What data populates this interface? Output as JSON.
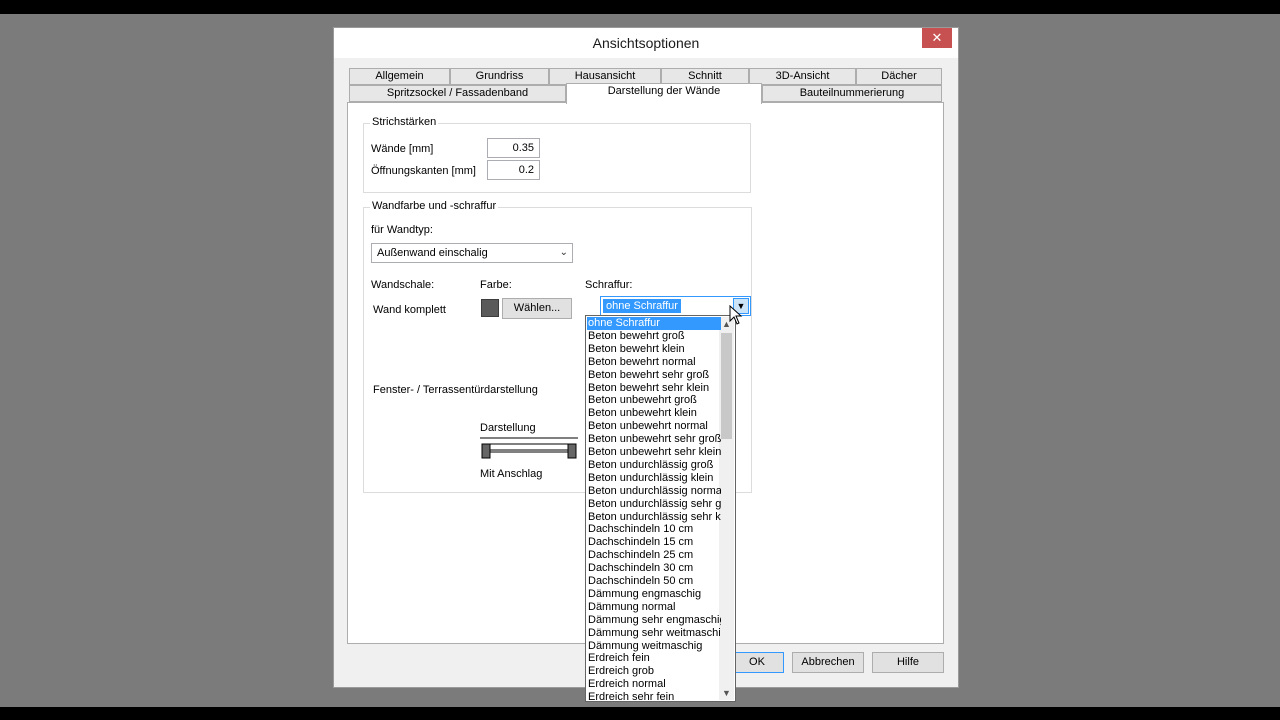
{
  "dialog": {
    "title": "Ansichtsoptionen",
    "close_label": "✕"
  },
  "tabs_row1": [
    "Allgemein",
    "Grundriss",
    "Hausansicht",
    "Schnitt",
    "3D-Ansicht",
    "Dächer"
  ],
  "tabs_row2": [
    "Spritzsockel / Fassadenband",
    "Darstellung der Wände",
    "Bauteilnummerierung"
  ],
  "active_tab": "Darstellung der Wände",
  "strichstaerken": {
    "title": "Strichstärken",
    "waende_label": "Wände [mm]",
    "waende_value": "0.35",
    "oeffnung_label": "Öffnungskanten [mm]",
    "oeffnung_value": "0.2"
  },
  "wandfarbe": {
    "title": "Wandfarbe und -schraffur",
    "wandtyp_label": "für Wandtyp:",
    "wandtyp_value": "Außenwand einschalig",
    "wandschale_label": "Wandschale:",
    "farbe_label": "Farbe:",
    "schraffur_label": "Schraffur:",
    "wand_label": "Wand komplett",
    "waehlen_label": "Wählen...",
    "swatch_color": "#5a5a5a",
    "schraffur_value": "ohne Schraffur",
    "fenster_label": "Fenster- / Terrassentürdarstellung",
    "darstellung_label": "Darstellung",
    "anschlag_label": "Mit Anschlag"
  },
  "dropdown_items": [
    "ohne Schraffur",
    "Beton bewehrt groß",
    "Beton bewehrt klein",
    "Beton bewehrt normal",
    "Beton bewehrt sehr groß",
    "Beton bewehrt sehr klein",
    "Beton unbewehrt groß",
    "Beton unbewehrt klein",
    "Beton unbewehrt normal",
    "Beton unbewehrt sehr groß",
    "Beton unbewehrt sehr klein",
    "Beton undurchlässig groß",
    "Beton undurchlässig klein",
    "Beton undurchlässig normal",
    "Beton undurchlässig sehr gr",
    "Beton undurchlässig sehr kle",
    "Dachschindeln 10 cm",
    "Dachschindeln 15 cm",
    "Dachschindeln 25 cm",
    "Dachschindeln 30 cm",
    "Dachschindeln 50 cm",
    "Dämmung engmaschig",
    "Dämmung normal",
    "Dämmung sehr engmaschig",
    "Dämmung sehr weitmaschig",
    "Dämmung weitmaschig",
    "Erdreich fein",
    "Erdreich grob",
    "Erdreich normal",
    "Erdreich sehr fein"
  ],
  "buttons": {
    "ok": "OK",
    "abbrechen": "Abbrechen",
    "hilfe": "Hilfe"
  },
  "colors": {
    "selection": "#3399ff",
    "close": "#c75050"
  }
}
